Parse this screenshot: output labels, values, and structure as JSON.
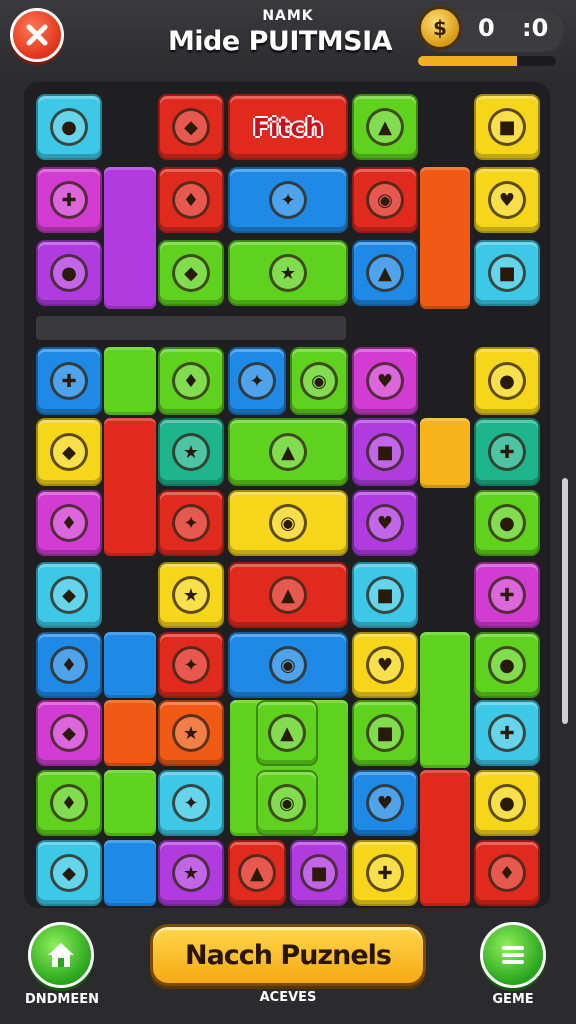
{
  "header": {
    "subtitle": "NAMK",
    "title": "Mide PUITMSIA",
    "score_left": "0",
    "score_right": ":0",
    "coin_glyph": "$",
    "progress": 0.72
  },
  "board": {
    "match_label": "Fitch"
  },
  "bottom": {
    "left_caption": "DNDMEEN",
    "main_button": "Nacch Puznels",
    "main_caption": "ACEVES",
    "right_caption": "GEME"
  },
  "colors": {
    "green": "#5ed21e",
    "red": "#e12a1e",
    "blue": "#1e8ae6",
    "cyan": "#3cc8e6",
    "yellow": "#f6d61a",
    "purple": "#b03ce0",
    "magenta": "#d23cd2",
    "orange": "#f05a14",
    "teal": "#1eb48c",
    "gold": "#f6b41a"
  }
}
